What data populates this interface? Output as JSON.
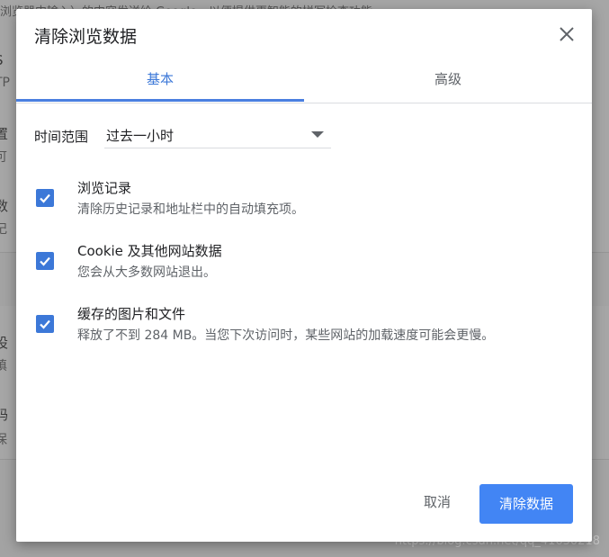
{
  "background": {
    "top_line": "浏览器中输入）的内容发送给 Google，以便提供更智能的拼写检查功能",
    "fragments": [
      "S",
      "TP",
      "置",
      "可",
      "数",
      "记",
      "设",
      "填",
      "码",
      "保"
    ],
    "watermark": "https://blog.csdn.net/qq_41630218"
  },
  "dialog": {
    "title": "清除浏览数据",
    "close_icon": "close-icon",
    "tabs": [
      {
        "label": "基本",
        "active": true
      },
      {
        "label": "高级",
        "active": false
      }
    ],
    "time_range": {
      "label": "时间范围",
      "value": "过去一小时"
    },
    "options": [
      {
        "title": "浏览记录",
        "description": "清除历史记录和地址栏中的自动填充项。",
        "checked": true
      },
      {
        "title": "Cookie 及其他网站数据",
        "description": "您会从大多数网站退出。",
        "checked": true
      },
      {
        "title": "缓存的图片和文件",
        "description": "释放了不到 284 MB。当您下次访问时，某些网站的加载速度可能会更慢。",
        "checked": true
      }
    ],
    "buttons": {
      "cancel": "取消",
      "clear": "清除数据"
    }
  },
  "colors": {
    "accent": "#4285f4",
    "tab_active": "#3c78d8"
  }
}
